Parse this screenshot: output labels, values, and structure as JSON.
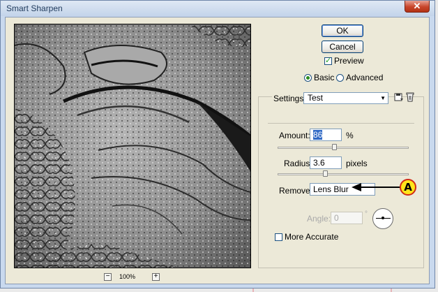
{
  "window": {
    "title": "Smart Sharpen",
    "close_label": "✕"
  },
  "buttons": {
    "ok": "OK",
    "cancel": "Cancel"
  },
  "preview_toggle": {
    "label": "Preview",
    "checked": true,
    "check_glyph": "✓"
  },
  "mode": {
    "basic": "Basic",
    "advanced": "Advanced",
    "selected": "Basic"
  },
  "settings": {
    "label": "Settings:",
    "value": "Test",
    "arrow": "▼"
  },
  "amount": {
    "label": "Amount:",
    "value": "86",
    "unit": "%",
    "slider_fraction": 0.43
  },
  "radius": {
    "label": "Radius:",
    "value": "3.6",
    "unit": "pixels",
    "slider_fraction": 0.36
  },
  "remove": {
    "label": "Remove:",
    "value": "Lens Blur"
  },
  "angle": {
    "label": "Angle:",
    "value": "0",
    "unit": "°"
  },
  "more_accurate": {
    "label": "More Accurate",
    "checked": false
  },
  "zoom": {
    "minus": "−",
    "level": "100%",
    "plus": "+"
  },
  "annotation": {
    "letter": "A"
  },
  "icons": {
    "save_settings": "floppy-disk-icon",
    "delete_settings": "trash-can-icon"
  },
  "colors": {
    "accent": "#316ac5",
    "annotation_fill": "#ffe41a",
    "annotation_stroke": "#d02a15"
  }
}
